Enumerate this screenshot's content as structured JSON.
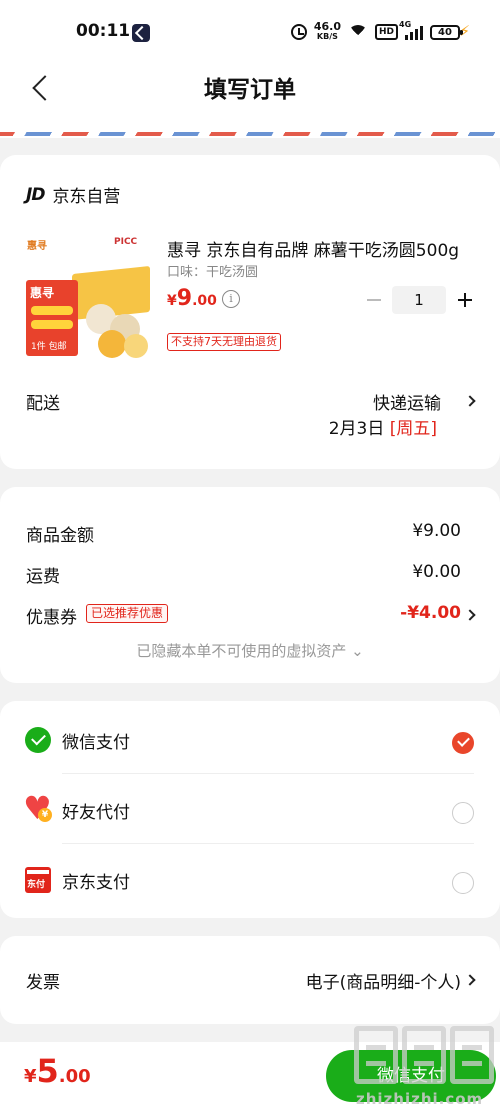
{
  "status_bar": {
    "time": "00:11",
    "net_speed_value": "46.0",
    "net_speed_unit": "KB/S",
    "hd_label": "HD",
    "signal_label": "4G",
    "battery": "40"
  },
  "nav": {
    "title": "填写订单",
    "back_icon": "chevron-left-icon"
  },
  "shop": {
    "logo": "JD",
    "name": "京东自营"
  },
  "product": {
    "title": "惠寻 京东自有品牌 麻薯干吃汤圆500g",
    "spec": "口味：干吃汤圆",
    "price_currency": "¥",
    "price_int": "9",
    "price_dec": ".00",
    "quantity": "1",
    "return_policy": "不支持7天无理由退货",
    "thumb": {
      "brand": "惠寻",
      "partner": "PICC",
      "band_title": "惠寻",
      "band_note": "1件 包邮"
    }
  },
  "delivery": {
    "label": "配送",
    "method": "快递运输",
    "date": "2月3日",
    "weekday": "[周五]"
  },
  "price_detail": {
    "goods_label": "商品金额",
    "goods_value": "¥9.00",
    "shipping_label": "运费",
    "shipping_value": "¥0.00",
    "coupon_label": "优惠券",
    "coupon_badge": "已选推荐优惠",
    "coupon_value": "-¥4.00",
    "hidden_note": "已隐藏本单不可使用的虚拟资产 ⌄"
  },
  "payment": {
    "options": [
      {
        "label": "微信支付",
        "icon": "wechat-pay-icon",
        "selected": true
      },
      {
        "label": "好友代付",
        "icon": "friend-pay-icon",
        "selected": false
      },
      {
        "label": "京东支付",
        "icon": "jd-pay-icon",
        "icon_text": "东付",
        "selected": false
      }
    ]
  },
  "invoice": {
    "label": "发票",
    "value": "电子(商品明细-个人)"
  },
  "footer": {
    "total_currency": "¥",
    "total_int": "5",
    "total_dec": ".00",
    "pay_button": "微信支付"
  },
  "watermark": {
    "text": "zhizhizhi.com"
  },
  "colors": {
    "accent_red": "#e1251b",
    "wechat_green": "#1aad19",
    "background": "#f2f2f2"
  }
}
